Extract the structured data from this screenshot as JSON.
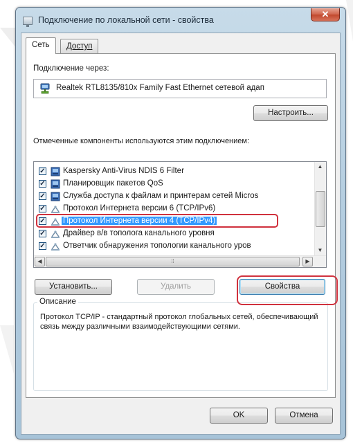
{
  "window": {
    "title": "Подключение по локальной сети - свойства",
    "close_glyph": "✕"
  },
  "tabs": [
    {
      "label": "Сеть",
      "active": true
    },
    {
      "label": "Доступ",
      "active": false
    }
  ],
  "connect_via": {
    "label": "Подключение через:",
    "adapter": "Realtek RTL8135/810x Family Fast Ethernet сетевой адап",
    "configure_label": "Настроить..."
  },
  "components": {
    "label": "Отмеченные компоненты используются этим подключением:",
    "items": [
      {
        "text": "Kaspersky Anti-Virus NDIS 6 Filter",
        "checked": true,
        "icon": "network-driver-icon"
      },
      {
        "text": "Планировщик пакетов QoS",
        "checked": true,
        "icon": "network-driver-icon"
      },
      {
        "text": "Служба доступа к файлам и принтерам сетей Micros",
        "checked": true,
        "icon": "network-driver-icon"
      },
      {
        "text": "Протокол Интернета версии 6 (TCP/IPv6)",
        "checked": true,
        "icon": "protocol-icon"
      },
      {
        "text": "Протокол Интернета версии 4 (TCP/IPv4)",
        "checked": true,
        "icon": "protocol-icon",
        "selected": true
      },
      {
        "text": "Драйвер в/в тополога канального уровня",
        "checked": true,
        "icon": "protocol-icon"
      },
      {
        "text": "Ответчик обнаружения топологии канального уров",
        "checked": true,
        "icon": "protocol-icon"
      }
    ]
  },
  "buttons": {
    "install": "Установить...",
    "uninstall": "Удалить",
    "properties": "Свойства",
    "ok": "OK",
    "cancel": "Отмена"
  },
  "description": {
    "title": "Описание",
    "text": "Протокол TCP/IP - стандартный протокол глобальных сетей, обеспечивающий связь между различными взаимодействующими сетями."
  },
  "colors": {
    "selection": "#3399ff",
    "highlight_ring": "#d0313d",
    "close_button": "#c24a2f"
  }
}
